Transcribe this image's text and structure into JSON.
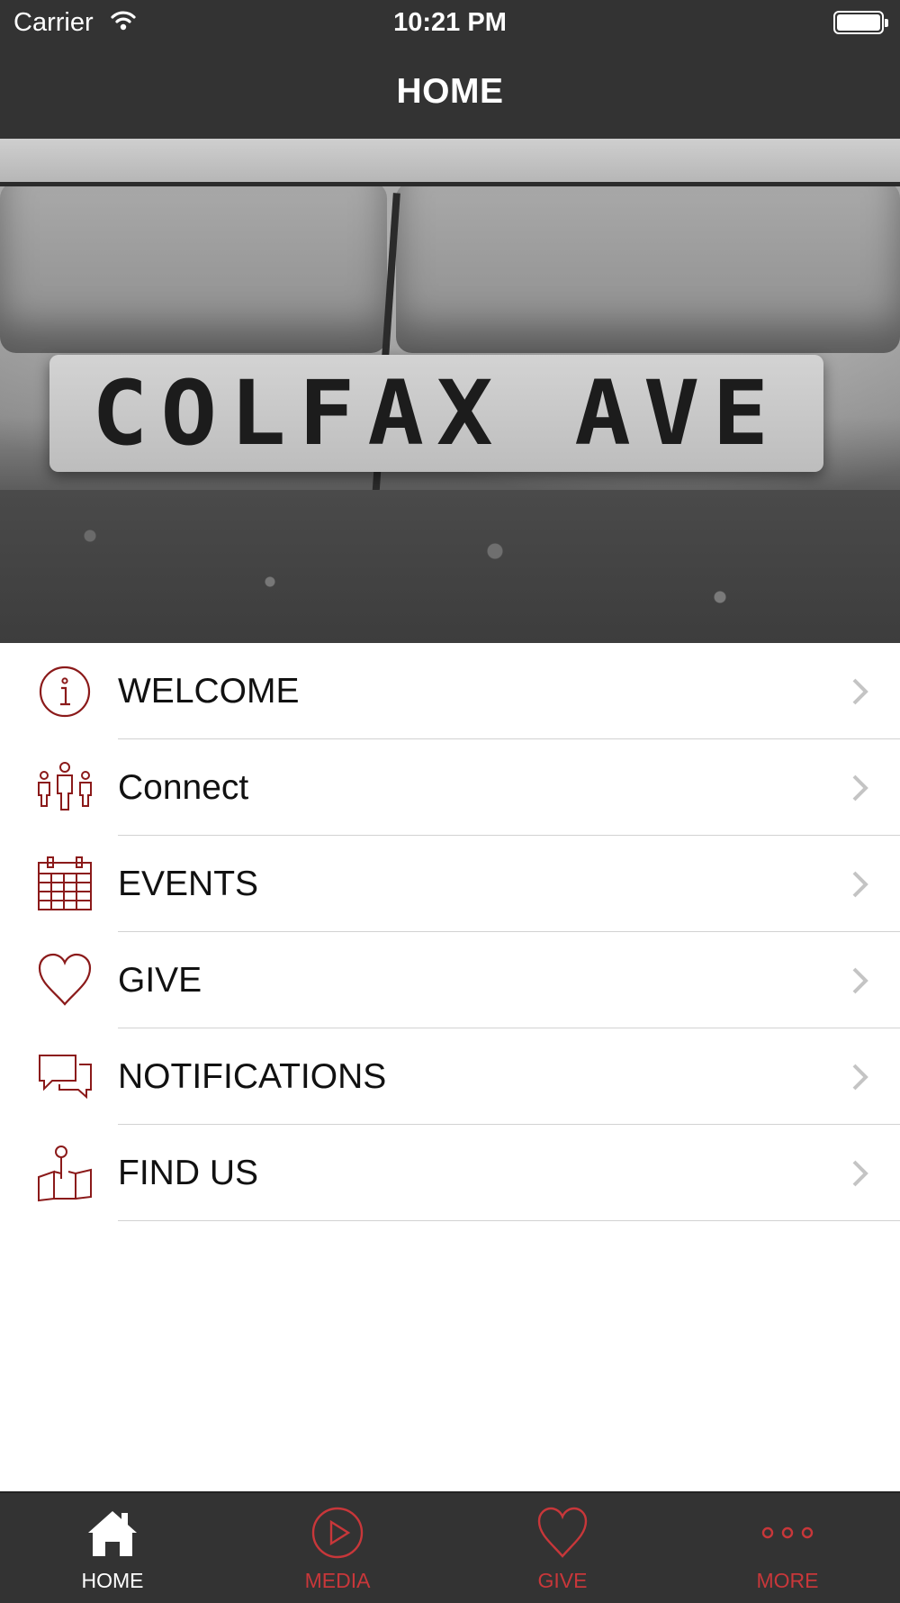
{
  "status_bar": {
    "carrier": "Carrier",
    "time": "10:21 PM"
  },
  "nav": {
    "title": "HOME"
  },
  "hero": {
    "stamp_text": "COLFAX AVE"
  },
  "menu": {
    "items": [
      {
        "label": "WELCOME",
        "icon": "info-icon"
      },
      {
        "label": "Connect",
        "icon": "people-icon"
      },
      {
        "label": "EVENTS",
        "icon": "calendar-icon"
      },
      {
        "label": "GIVE",
        "icon": "heart-icon"
      },
      {
        "label": "NOTIFICATIONS",
        "icon": "chat-bubbles-icon"
      },
      {
        "label": "FIND US",
        "icon": "map-pin-icon"
      }
    ]
  },
  "tabbar": {
    "tabs": [
      {
        "label": "HOME",
        "icon": "home-icon",
        "selected": true
      },
      {
        "label": "MEDIA",
        "icon": "play-icon",
        "selected": false
      },
      {
        "label": "GIVE",
        "icon": "heart-icon",
        "selected": false
      },
      {
        "label": "MORE",
        "icon": "more-dots-icon",
        "selected": false
      }
    ]
  },
  "colors": {
    "bar_bg": "#333333",
    "accent": "#8b1a1a",
    "tab_inactive": "#c8373a",
    "tab_active": "#ffffff"
  }
}
